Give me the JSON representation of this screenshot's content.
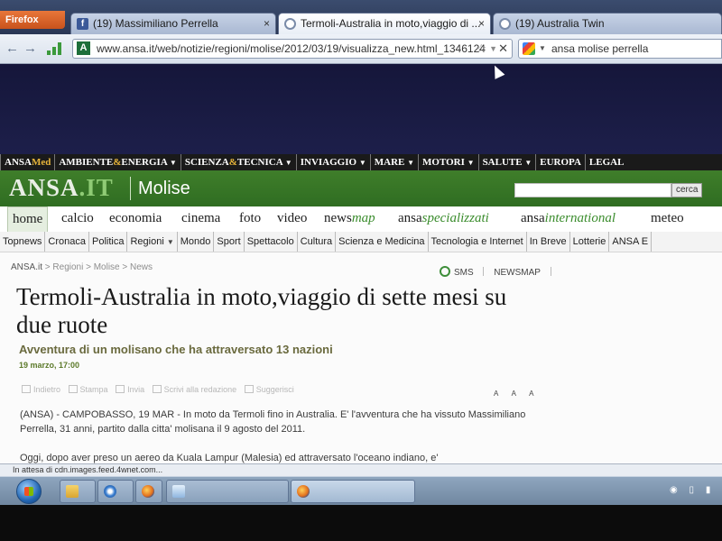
{
  "browser": {
    "menu_button": "Firefox",
    "tabs": [
      {
        "label": "(19) Massimiliano Perrella",
        "icon": "facebook-icon"
      },
      {
        "label": "Termoli-Australia in moto,viaggio di ...",
        "icon": "ansa-icon",
        "active": true
      },
      {
        "label": "(19) Australia Twin",
        "icon": "loading-icon"
      }
    ],
    "tab_close": "×",
    "back": "←",
    "forward": "→",
    "url": "www.ansa.it/web/notizie/regioni/molise/2012/03/19/visualizza_new.html_1346124",
    "star": "☆",
    "url_drop": "▼",
    "url_close": "✕",
    "search_value": "ansa molise perrella",
    "search_drop": "▼"
  },
  "site": {
    "topbar": [
      {
        "prefix": "ANSA",
        "highlight": "Med",
        "suffix": "",
        "arrow": false
      },
      {
        "prefix": "AMBIENTE",
        "highlight": "&",
        "suffix": "ENERGIA",
        "arrow": true
      },
      {
        "prefix": "SCIENZA",
        "highlight": "&",
        "suffix": "TECNICA",
        "arrow": true
      },
      {
        "prefix": "IN",
        "highlight": "",
        "suffix": "VIAGGIO",
        "arrow": true
      },
      {
        "prefix": "MARE",
        "highlight": "",
        "suffix": "",
        "arrow": true
      },
      {
        "prefix": "MOTORI",
        "highlight": "",
        "suffix": "",
        "arrow": true
      },
      {
        "prefix": "SALUTE",
        "highlight": "",
        "suffix": "",
        "arrow": true
      },
      {
        "prefix": "EUROPA",
        "highlight": "",
        "suffix": "",
        "arrow": false
      },
      {
        "prefix": "LEGAL",
        "highlight": "",
        "suffix": "",
        "arrow": false
      }
    ],
    "arrow_glyph": "▼",
    "logo_main": "ANSA",
    "logo_it": ".IT",
    "region": "Molise",
    "search_button": "cerca",
    "main_nav": [
      {
        "label": "home",
        "accent": ""
      },
      {
        "label": "calcio",
        "accent": ""
      },
      {
        "label": "economia",
        "accent": ""
      },
      {
        "label": "cinema",
        "accent": ""
      },
      {
        "label": "foto",
        "accent": ""
      },
      {
        "label": "video",
        "accent": ""
      },
      {
        "label": "news",
        "accent": "map"
      },
      {
        "label": "ansa",
        "accent": "specializzati"
      },
      {
        "label": "ansa",
        "accent": "international"
      },
      {
        "label": "meteo",
        "accent": ""
      }
    ],
    "sub_nav": [
      "Topnews",
      "Cronaca",
      "Politica",
      "Regioni",
      "Mondo",
      "Sport",
      "Spettacolo",
      "Cultura",
      "Scienza e Medicina",
      "Tecnologia e Internet",
      "In Breve",
      "Lotterie",
      "ANSA E"
    ],
    "breadcrumb": {
      "home": "ANSA.it",
      "rest": " > Regioni > Molise > News"
    },
    "tools": {
      "sms": "SMS",
      "newsmap": "NEWSMAP"
    },
    "article": {
      "headline": "Termoli-Australia in moto,viaggio di sette mesi su due ruote",
      "subtitle": "Avventura di un molisano che ha attraversato 13 nazioni",
      "date": "19 marzo, 17:00",
      "actions": [
        "Indietro",
        "Stampa",
        "Invia",
        "Scrivi alla redazione",
        "Suggerisci"
      ],
      "fontsize": [
        "A",
        "A",
        "A"
      ],
      "paragraphs": [
        "(ANSA) - CAMPOBASSO, 19 MAR - In moto da Termoli fino in Australia. E' l'avventura che ha vissuto Massimiliano Perrella, 31 anni, partito dalla citta' molisana il 9 agosto del 2011.",
        "Oggi, dopo aver preso un aereo da Kuala Lampur (Malesia) ed attraversato l'oceano indiano, e'"
      ]
    }
  },
  "status": {
    "text": "In attesa di cdn.images.feed.4wnet.com..."
  },
  "colors": {
    "ansa_green": "#2f6d22",
    "accent_green": "#3a8c2c",
    "topbar_bg": "#1a1a1a"
  }
}
